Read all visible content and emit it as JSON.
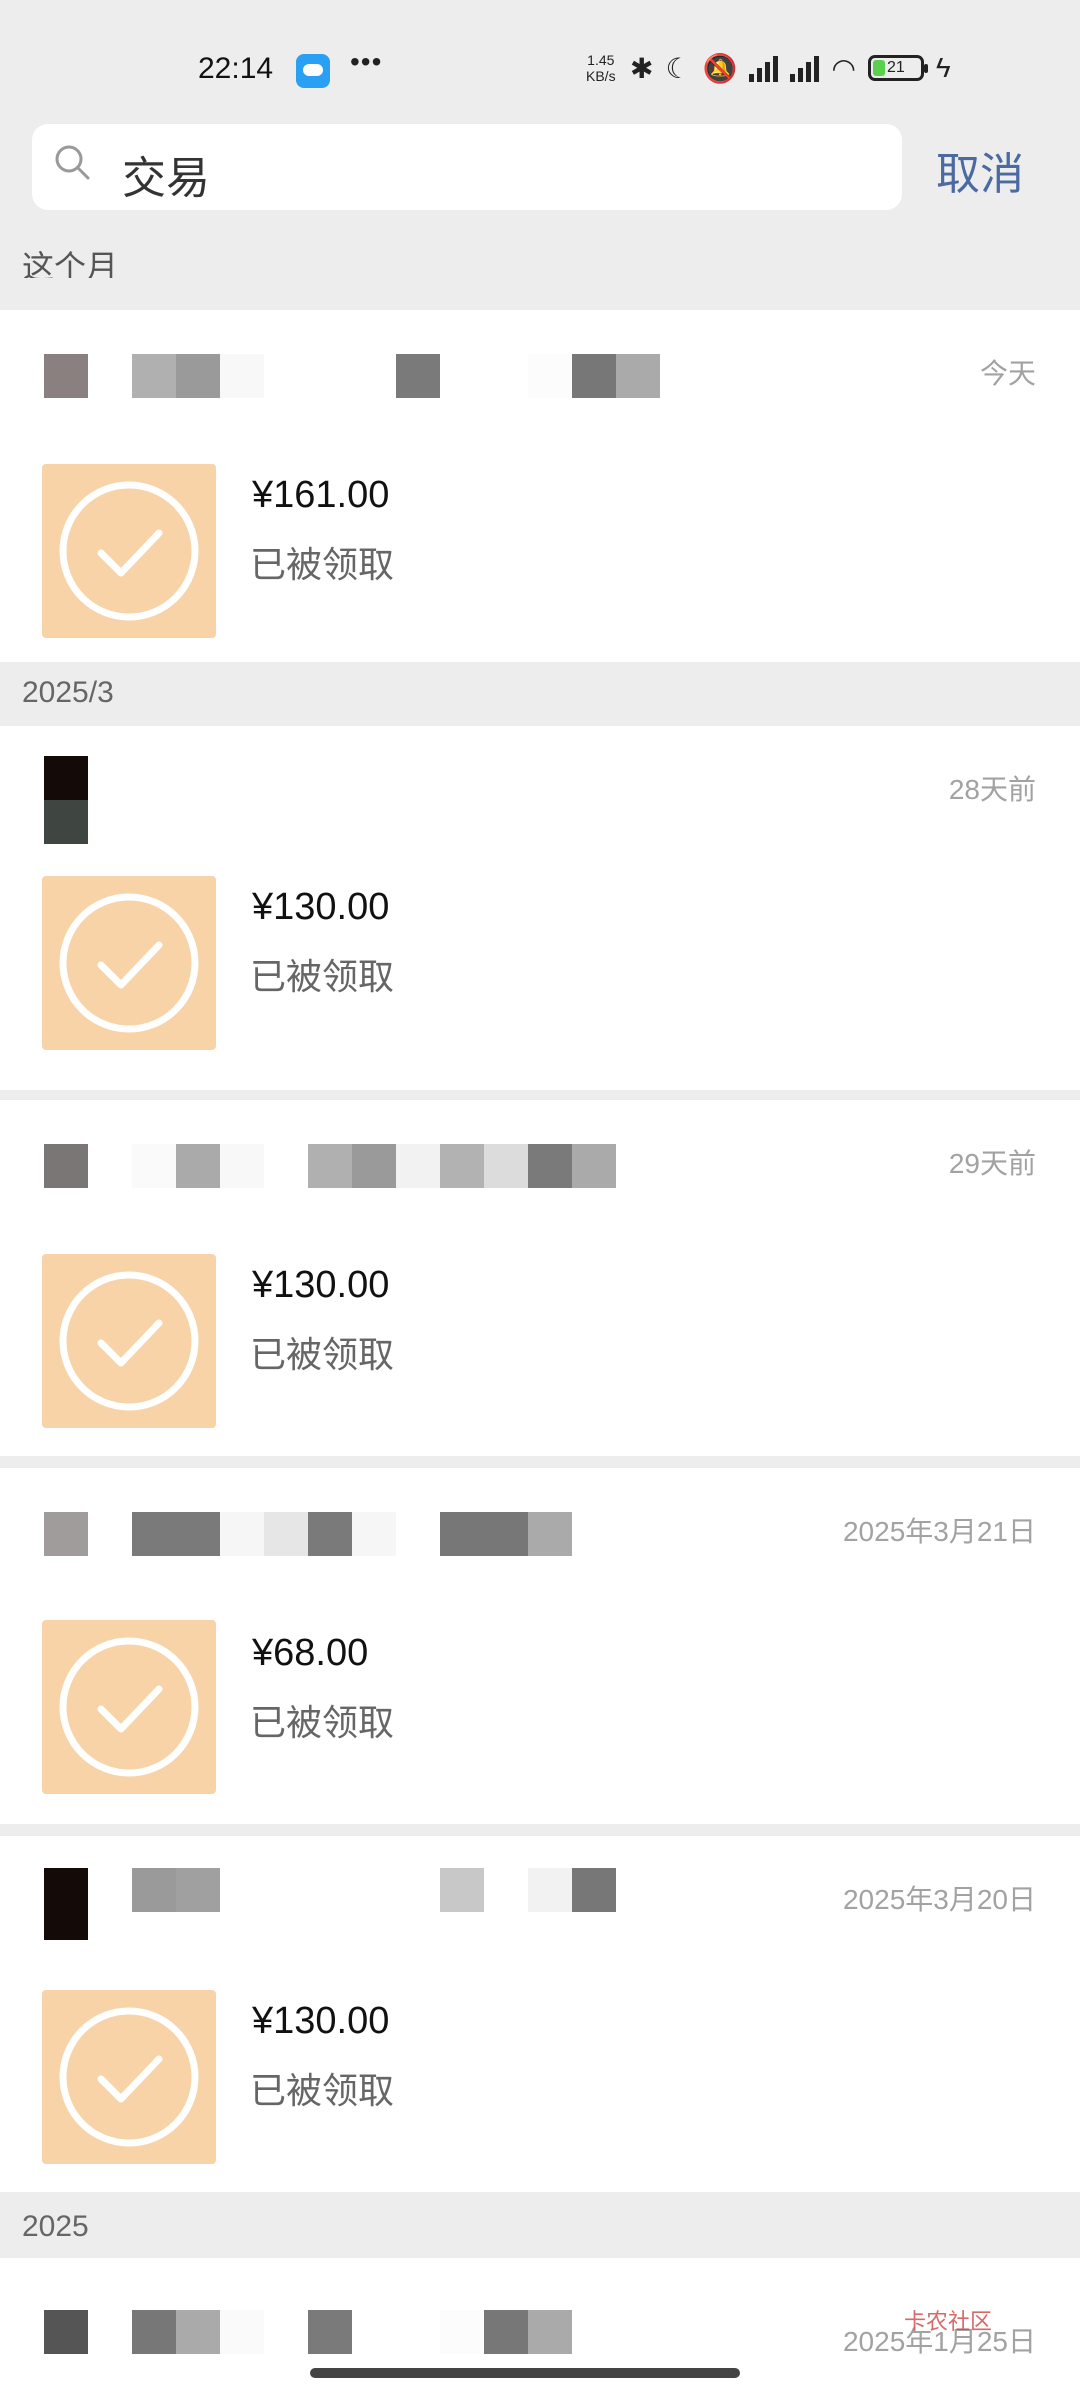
{
  "status": {
    "time": "22:14",
    "speed_top": "1.45",
    "speed_bottom": "KB/s",
    "battery": "21"
  },
  "search": {
    "query": "交易",
    "cancel": "取消"
  },
  "sections": {
    "partial_top": "这个月",
    "march": "2025/3",
    "partial_bottom": "2025"
  },
  "transactions": [
    {
      "date": "今天",
      "amount": "¥161.00",
      "status": "已被领取"
    },
    {
      "date": "28天前",
      "amount": "¥130.00",
      "status": "已被领取"
    },
    {
      "date": "29天前",
      "amount": "¥130.00",
      "status": "已被领取"
    },
    {
      "date": "2025年3月21日",
      "amount": "¥68.00",
      "status": "已被领取"
    },
    {
      "date": "2025年3月20日",
      "amount": "¥130.00",
      "status": "已被领取"
    },
    {
      "date": "2025年1月25日",
      "amount": "",
      "status": ""
    }
  ],
  "watermark": "卡农社区",
  "colors": {
    "packet": "#f7d3a7",
    "cancel": "#4b6aa1",
    "background": "#ededed"
  }
}
